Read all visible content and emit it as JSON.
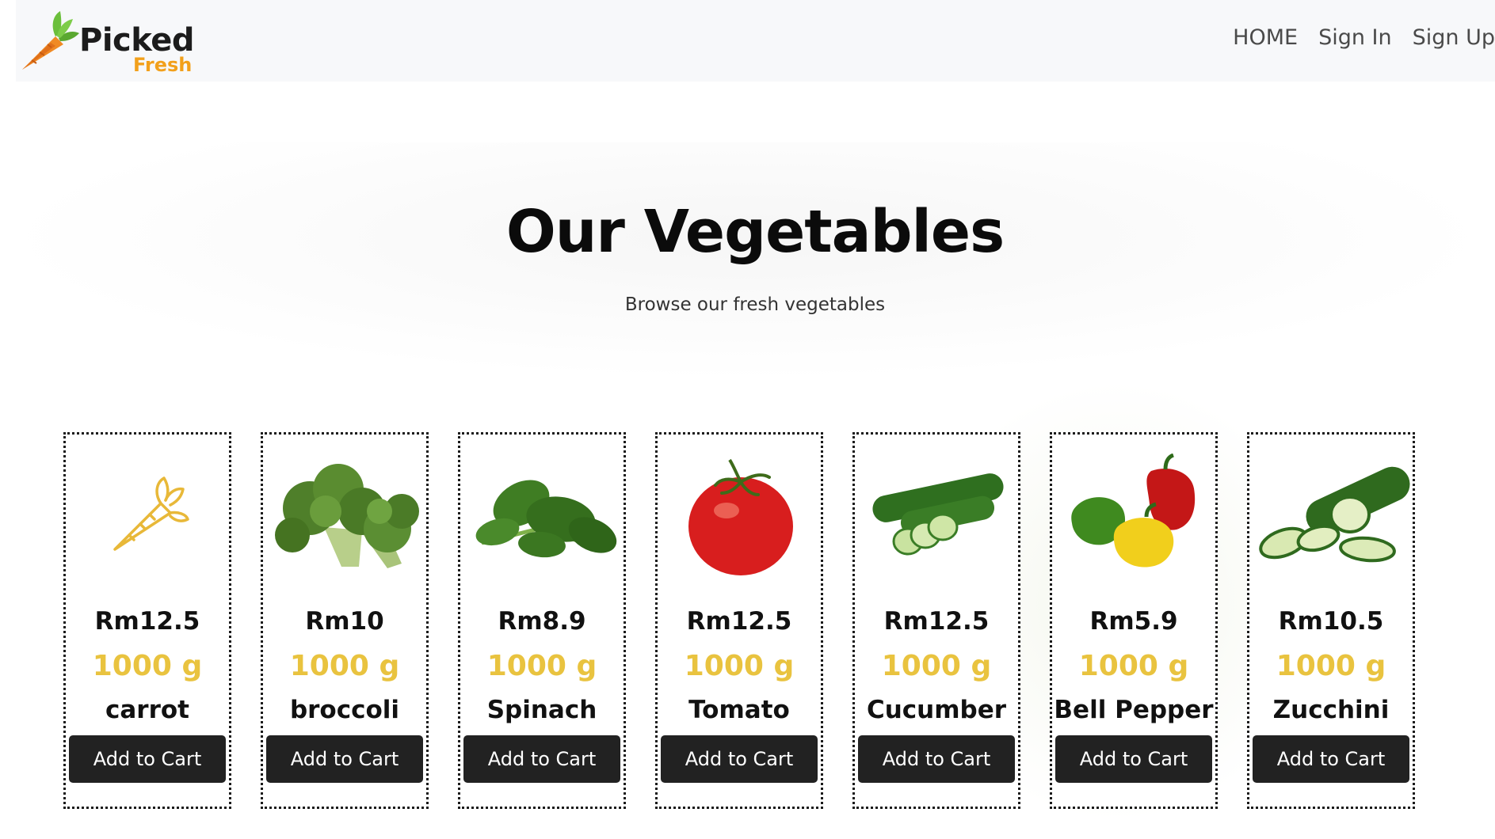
{
  "brand": {
    "name_line1": "Picked",
    "name_line2": "Fresh",
    "icon": "carrot-logo-icon",
    "accent": "#f2a01b"
  },
  "nav": {
    "items": [
      {
        "label": "HOME"
      },
      {
        "label": "Sign In"
      },
      {
        "label": "Sign Up"
      }
    ]
  },
  "hero": {
    "title": "Our Vegetables",
    "subtitle": "Browse our fresh vegetables"
  },
  "products": [
    {
      "price": "Rm12.5",
      "weight": "1000 g",
      "name": "carrot",
      "button": "Add to Cart",
      "icon": "carrot-outline-icon"
    },
    {
      "price": "Rm10",
      "weight": "1000 g",
      "name": "broccoli",
      "button": "Add to Cart",
      "icon": "broccoli-image"
    },
    {
      "price": "Rm8.9",
      "weight": "1000 g",
      "name": "Spinach",
      "button": "Add to Cart",
      "icon": "spinach-image"
    },
    {
      "price": "Rm12.5",
      "weight": "1000 g",
      "name": "Tomato",
      "button": "Add to Cart",
      "icon": "tomato-image"
    },
    {
      "price": "Rm12.5",
      "weight": "1000 g",
      "name": "Cucumber",
      "button": "Add to Cart",
      "icon": "cucumber-image"
    },
    {
      "price": "Rm5.9",
      "weight": "1000 g",
      "name": "Bell Pepper",
      "button": "Add to Cart",
      "icon": "bell-pepper-image"
    },
    {
      "price": "Rm10.5",
      "weight": "1000 g",
      "name": "Zucchini",
      "button": "Add to Cart",
      "icon": "zucchini-image"
    }
  ],
  "colors": {
    "weight_text": "#e9c33f",
    "button_bg": "#222222",
    "navbar_bg": "#f7f8fa"
  }
}
